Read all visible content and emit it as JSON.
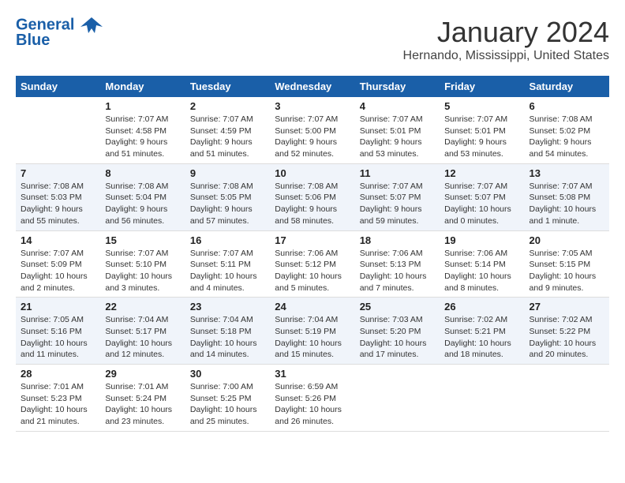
{
  "header": {
    "logo_line1": "General",
    "logo_line2": "Blue",
    "month": "January 2024",
    "location": "Hernando, Mississippi, United States"
  },
  "weekdays": [
    "Sunday",
    "Monday",
    "Tuesday",
    "Wednesday",
    "Thursday",
    "Friday",
    "Saturday"
  ],
  "weeks": [
    [
      {
        "num": "",
        "sunrise": "",
        "sunset": "",
        "daylight": ""
      },
      {
        "num": "1",
        "sunrise": "Sunrise: 7:07 AM",
        "sunset": "Sunset: 4:58 PM",
        "daylight": "Daylight: 9 hours and 51 minutes."
      },
      {
        "num": "2",
        "sunrise": "Sunrise: 7:07 AM",
        "sunset": "Sunset: 4:59 PM",
        "daylight": "Daylight: 9 hours and 51 minutes."
      },
      {
        "num": "3",
        "sunrise": "Sunrise: 7:07 AM",
        "sunset": "Sunset: 5:00 PM",
        "daylight": "Daylight: 9 hours and 52 minutes."
      },
      {
        "num": "4",
        "sunrise": "Sunrise: 7:07 AM",
        "sunset": "Sunset: 5:01 PM",
        "daylight": "Daylight: 9 hours and 53 minutes."
      },
      {
        "num": "5",
        "sunrise": "Sunrise: 7:07 AM",
        "sunset": "Sunset: 5:01 PM",
        "daylight": "Daylight: 9 hours and 53 minutes."
      },
      {
        "num": "6",
        "sunrise": "Sunrise: 7:08 AM",
        "sunset": "Sunset: 5:02 PM",
        "daylight": "Daylight: 9 hours and 54 minutes."
      }
    ],
    [
      {
        "num": "7",
        "sunrise": "Sunrise: 7:08 AM",
        "sunset": "Sunset: 5:03 PM",
        "daylight": "Daylight: 9 hours and 55 minutes."
      },
      {
        "num": "8",
        "sunrise": "Sunrise: 7:08 AM",
        "sunset": "Sunset: 5:04 PM",
        "daylight": "Daylight: 9 hours and 56 minutes."
      },
      {
        "num": "9",
        "sunrise": "Sunrise: 7:08 AM",
        "sunset": "Sunset: 5:05 PM",
        "daylight": "Daylight: 9 hours and 57 minutes."
      },
      {
        "num": "10",
        "sunrise": "Sunrise: 7:08 AM",
        "sunset": "Sunset: 5:06 PM",
        "daylight": "Daylight: 9 hours and 58 minutes."
      },
      {
        "num": "11",
        "sunrise": "Sunrise: 7:07 AM",
        "sunset": "Sunset: 5:07 PM",
        "daylight": "Daylight: 9 hours and 59 minutes."
      },
      {
        "num": "12",
        "sunrise": "Sunrise: 7:07 AM",
        "sunset": "Sunset: 5:07 PM",
        "daylight": "Daylight: 10 hours and 0 minutes."
      },
      {
        "num": "13",
        "sunrise": "Sunrise: 7:07 AM",
        "sunset": "Sunset: 5:08 PM",
        "daylight": "Daylight: 10 hours and 1 minute."
      }
    ],
    [
      {
        "num": "14",
        "sunrise": "Sunrise: 7:07 AM",
        "sunset": "Sunset: 5:09 PM",
        "daylight": "Daylight: 10 hours and 2 minutes."
      },
      {
        "num": "15",
        "sunrise": "Sunrise: 7:07 AM",
        "sunset": "Sunset: 5:10 PM",
        "daylight": "Daylight: 10 hours and 3 minutes."
      },
      {
        "num": "16",
        "sunrise": "Sunrise: 7:07 AM",
        "sunset": "Sunset: 5:11 PM",
        "daylight": "Daylight: 10 hours and 4 minutes."
      },
      {
        "num": "17",
        "sunrise": "Sunrise: 7:06 AM",
        "sunset": "Sunset: 5:12 PM",
        "daylight": "Daylight: 10 hours and 5 minutes."
      },
      {
        "num": "18",
        "sunrise": "Sunrise: 7:06 AM",
        "sunset": "Sunset: 5:13 PM",
        "daylight": "Daylight: 10 hours and 7 minutes."
      },
      {
        "num": "19",
        "sunrise": "Sunrise: 7:06 AM",
        "sunset": "Sunset: 5:14 PM",
        "daylight": "Daylight: 10 hours and 8 minutes."
      },
      {
        "num": "20",
        "sunrise": "Sunrise: 7:05 AM",
        "sunset": "Sunset: 5:15 PM",
        "daylight": "Daylight: 10 hours and 9 minutes."
      }
    ],
    [
      {
        "num": "21",
        "sunrise": "Sunrise: 7:05 AM",
        "sunset": "Sunset: 5:16 PM",
        "daylight": "Daylight: 10 hours and 11 minutes."
      },
      {
        "num": "22",
        "sunrise": "Sunrise: 7:04 AM",
        "sunset": "Sunset: 5:17 PM",
        "daylight": "Daylight: 10 hours and 12 minutes."
      },
      {
        "num": "23",
        "sunrise": "Sunrise: 7:04 AM",
        "sunset": "Sunset: 5:18 PM",
        "daylight": "Daylight: 10 hours and 14 minutes."
      },
      {
        "num": "24",
        "sunrise": "Sunrise: 7:04 AM",
        "sunset": "Sunset: 5:19 PM",
        "daylight": "Daylight: 10 hours and 15 minutes."
      },
      {
        "num": "25",
        "sunrise": "Sunrise: 7:03 AM",
        "sunset": "Sunset: 5:20 PM",
        "daylight": "Daylight: 10 hours and 17 minutes."
      },
      {
        "num": "26",
        "sunrise": "Sunrise: 7:02 AM",
        "sunset": "Sunset: 5:21 PM",
        "daylight": "Daylight: 10 hours and 18 minutes."
      },
      {
        "num": "27",
        "sunrise": "Sunrise: 7:02 AM",
        "sunset": "Sunset: 5:22 PM",
        "daylight": "Daylight: 10 hours and 20 minutes."
      }
    ],
    [
      {
        "num": "28",
        "sunrise": "Sunrise: 7:01 AM",
        "sunset": "Sunset: 5:23 PM",
        "daylight": "Daylight: 10 hours and 21 minutes."
      },
      {
        "num": "29",
        "sunrise": "Sunrise: 7:01 AM",
        "sunset": "Sunset: 5:24 PM",
        "daylight": "Daylight: 10 hours and 23 minutes."
      },
      {
        "num": "30",
        "sunrise": "Sunrise: 7:00 AM",
        "sunset": "Sunset: 5:25 PM",
        "daylight": "Daylight: 10 hours and 25 minutes."
      },
      {
        "num": "31",
        "sunrise": "Sunrise: 6:59 AM",
        "sunset": "Sunset: 5:26 PM",
        "daylight": "Daylight: 10 hours and 26 minutes."
      },
      {
        "num": "",
        "sunrise": "",
        "sunset": "",
        "daylight": ""
      },
      {
        "num": "",
        "sunrise": "",
        "sunset": "",
        "daylight": ""
      },
      {
        "num": "",
        "sunrise": "",
        "sunset": "",
        "daylight": ""
      }
    ]
  ]
}
